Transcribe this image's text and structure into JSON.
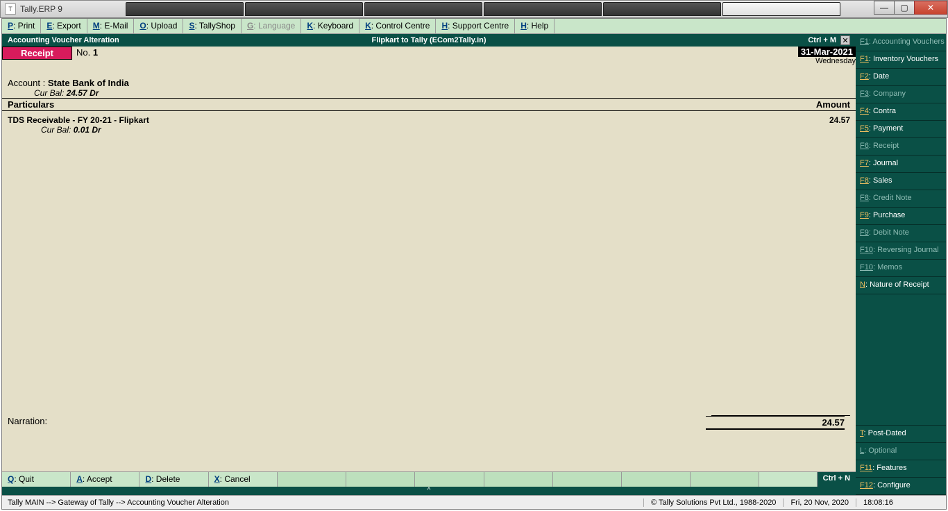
{
  "window": {
    "title": "Tally.ERP 9"
  },
  "topmenu": [
    {
      "key": "P",
      "label": "Print",
      "disabled": false
    },
    {
      "key": "E",
      "label": "Export",
      "disabled": false
    },
    {
      "key": "M",
      "label": "E-Mail",
      "disabled": false
    },
    {
      "key": "O",
      "label": "Upload",
      "disabled": false
    },
    {
      "key": "S",
      "label": "TallyShop",
      "disabled": false
    },
    {
      "key": "G",
      "label": "Language",
      "disabled": true
    },
    {
      "key": "K",
      "label": "Keyboard",
      "disabled": false
    },
    {
      "key": "K",
      "label": "Control Centre",
      "disabled": false
    },
    {
      "key": "H",
      "label": "Support Centre",
      "disabled": false
    },
    {
      "key": "H",
      "label": "Help",
      "disabled": false
    }
  ],
  "header": {
    "left": "Accounting Voucher  Alteration",
    "center": "Flipkart to Tally (ECom2Tally.in)",
    "shortcut": "Ctrl + M"
  },
  "voucher": {
    "type": "Receipt",
    "no_label": "No.",
    "no_value": "1",
    "date": "31-Mar-2021",
    "day": "Wednesday",
    "account_label": "Account :",
    "account_name": "State Bank of India",
    "curbal_label": "Cur Bal:",
    "curbal_value": "24.57 Dr",
    "col_particulars": "Particulars",
    "col_amount": "Amount",
    "entries": [
      {
        "name": "TDS Receivable - FY 20-21 - Flipkart",
        "amount": "24.57",
        "bal_label": "Cur Bal:",
        "bal_value": "0.01 Dr"
      }
    ],
    "narration_label": "Narration:",
    "total": "24.57"
  },
  "bottombar": [
    {
      "key": "Q",
      "label": "Quit"
    },
    {
      "key": "A",
      "label": "Accept"
    },
    {
      "key": "D",
      "label": "Delete"
    },
    {
      "key": "X",
      "label": "Cancel"
    }
  ],
  "bottom_shortcut": "Ctrl + N",
  "fkeys": [
    {
      "k": "F1",
      "label": "Accounting Vouchers",
      "active": false
    },
    {
      "k": "F1",
      "label": "Inventory Vouchers",
      "active": true
    },
    {
      "k": "F2",
      "label": "Date",
      "active": true
    },
    {
      "k": "F3",
      "label": "Company",
      "active": false
    },
    {
      "k": "F4",
      "label": "Contra",
      "active": true
    },
    {
      "k": "F5",
      "label": "Payment",
      "active": true
    },
    {
      "k": "F6",
      "label": "Receipt",
      "active": false
    },
    {
      "k": "F7",
      "label": "Journal",
      "active": true
    },
    {
      "k": "F8",
      "label": "Sales",
      "active": true
    },
    {
      "k": "F8",
      "label": "Credit Note",
      "active": false
    },
    {
      "k": "F9",
      "label": "Purchase",
      "active": true
    },
    {
      "k": "F9",
      "label": "Debit Note",
      "active": false
    },
    {
      "k": "F10",
      "label": "Reversing Journal",
      "active": false
    },
    {
      "k": "F10",
      "label": "Memos",
      "active": false
    },
    {
      "k": "N",
      "label": "Nature of Receipt",
      "active": true
    }
  ],
  "fkeys_bottom": [
    {
      "k": "T",
      "label": "Post-Dated",
      "active": true
    },
    {
      "k": "L",
      "label": "Optional",
      "active": false
    },
    {
      "k": "F11",
      "label": "Features",
      "active": true
    },
    {
      "k": "F12",
      "label": "Configure",
      "active": true
    }
  ],
  "status": {
    "crumb": "Tally MAIN -->  Gateway of Tally -->  Accounting Voucher  Alteration",
    "copyright": "© Tally Solutions Pvt Ltd., 1988-2020",
    "date": "Fri, 20 Nov, 2020",
    "time": "18:08:16"
  }
}
